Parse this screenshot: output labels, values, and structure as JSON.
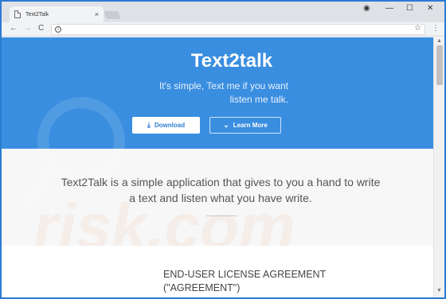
{
  "browser": {
    "tab_title": "Text2Talk",
    "tab_close": "×",
    "window": {
      "profile": "◉",
      "minimize": "—",
      "maximize": "☐",
      "close": "✕"
    },
    "nav": {
      "back": "←",
      "forward": "→",
      "reload": "C"
    },
    "omnibox_value": "",
    "star": "☆",
    "menu": "⋮"
  },
  "hero": {
    "title": "Text2talk",
    "subtitle_line1": "It's simple, Text me if you want",
    "subtitle_line2": "listen me talk.",
    "download_label": "Download",
    "download_icon": "⤓",
    "learn_more_label": "Learn More",
    "learn_more_icon": "⌄"
  },
  "intro": {
    "line1": "Text2Talk is a simple application that gives to you a hand to write",
    "line2": "a text and listen what you have write."
  },
  "eula": {
    "title_line1": "END-USER LICENSE AGREEMENT",
    "title_line2": "(\"AGREEMENT\")"
  },
  "scrollbar": {
    "up": "▲",
    "down": "▼"
  },
  "colors": {
    "hero": "#3a8ee0",
    "frame": "#2b7bd0",
    "button_text": "#2f7fd4"
  },
  "watermark": "risk.com"
}
